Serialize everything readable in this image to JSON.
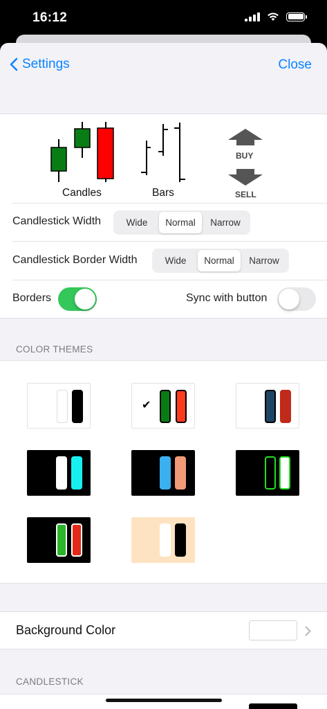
{
  "status": {
    "time": "16:12"
  },
  "nav": {
    "back_label": "Settings",
    "close_label": "Close"
  },
  "chart_types": {
    "candles_label": "Candles",
    "bars_label": "Bars",
    "buy_label": "BUY",
    "sell_label": "SELL"
  },
  "candlestick_width": {
    "label": "Candlestick Width",
    "options": [
      "Wide",
      "Normal",
      "Narrow"
    ],
    "selected": "Normal"
  },
  "border_width": {
    "label": "Candlestick Border Width",
    "options": [
      "Wide",
      "Normal",
      "Narrow"
    ],
    "selected": "Normal"
  },
  "borders": {
    "label": "Borders",
    "on": true
  },
  "sync": {
    "label": "Sync with button",
    "on": false
  },
  "color_themes": {
    "header": "COLOR THEMES",
    "selected_mark": "✔"
  },
  "background": {
    "label": "Background Color",
    "color": "#ffffff"
  },
  "candlestick_section": {
    "header": "CANDLESTICK"
  },
  "colors": {
    "accent": "#0a84ff",
    "toggle_on": "#34c759",
    "candle_green": "#008000",
    "candle_red": "#ff0000"
  }
}
